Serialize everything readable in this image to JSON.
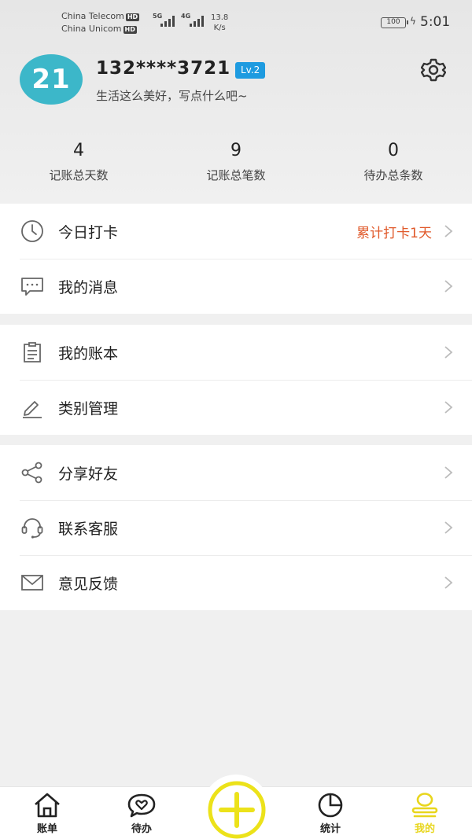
{
  "status_bar": {
    "carrier_1": "China Telecom",
    "carrier_2": "China Unicom",
    "hd": "HD",
    "net_1": "5G",
    "net_2": "4G",
    "speed_value": "13.8",
    "speed_unit": "K/s",
    "battery": "100",
    "time": "5:01"
  },
  "profile": {
    "avatar_text": "21",
    "username": "132****3721",
    "level": "Lv.2",
    "signature": "生活这么美好，写点什么吧~",
    "avatar_color": "#3cb7c9"
  },
  "stats": [
    {
      "value": "4",
      "label": "记账总天数"
    },
    {
      "value": "9",
      "label": "记账总笔数"
    },
    {
      "value": "0",
      "label": "待办总条数"
    }
  ],
  "menu": {
    "group_1": [
      {
        "label": "今日打卡",
        "extra": "累计打卡1天",
        "icon": "clock-icon"
      },
      {
        "label": "我的消息",
        "icon": "message-icon"
      }
    ],
    "group_2": [
      {
        "label": "我的账本",
        "icon": "ledger-icon"
      },
      {
        "label": "类别管理",
        "icon": "edit-icon"
      }
    ],
    "group_3": [
      {
        "label": "分享好友",
        "icon": "share-icon"
      },
      {
        "label": "联系客服",
        "icon": "headset-icon"
      },
      {
        "label": "意见反馈",
        "icon": "mail-icon"
      }
    ]
  },
  "tabbar": {
    "tabs": [
      {
        "label": "账单",
        "icon": "home-icon"
      },
      {
        "label": "待办",
        "icon": "heart-chat-icon"
      },
      {
        "label": "统计",
        "icon": "pie-chart-icon"
      },
      {
        "label": "我的",
        "icon": "profile-icon"
      }
    ],
    "active_index": 3,
    "accent_color": "#e8d61d"
  }
}
